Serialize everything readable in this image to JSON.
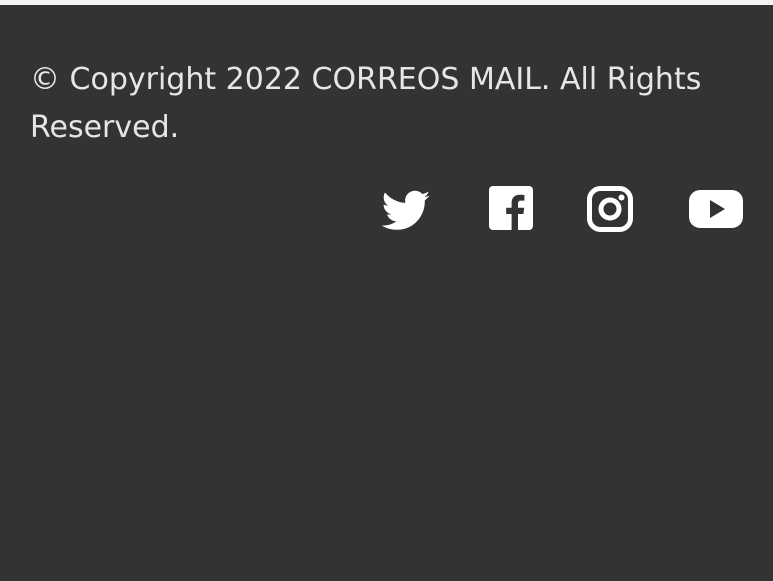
{
  "footer": {
    "copyright": "© Copyright 2022 CORREOS MAIL. All Rights Reserved.",
    "social_icons": [
      "twitter-icon",
      "facebook-icon",
      "instagram-icon",
      "youtube-icon"
    ],
    "colors": {
      "background": "#333333",
      "text": "#e6e6e6",
      "icon": "#ffffff",
      "top_strip": "#f3f3f3"
    }
  }
}
